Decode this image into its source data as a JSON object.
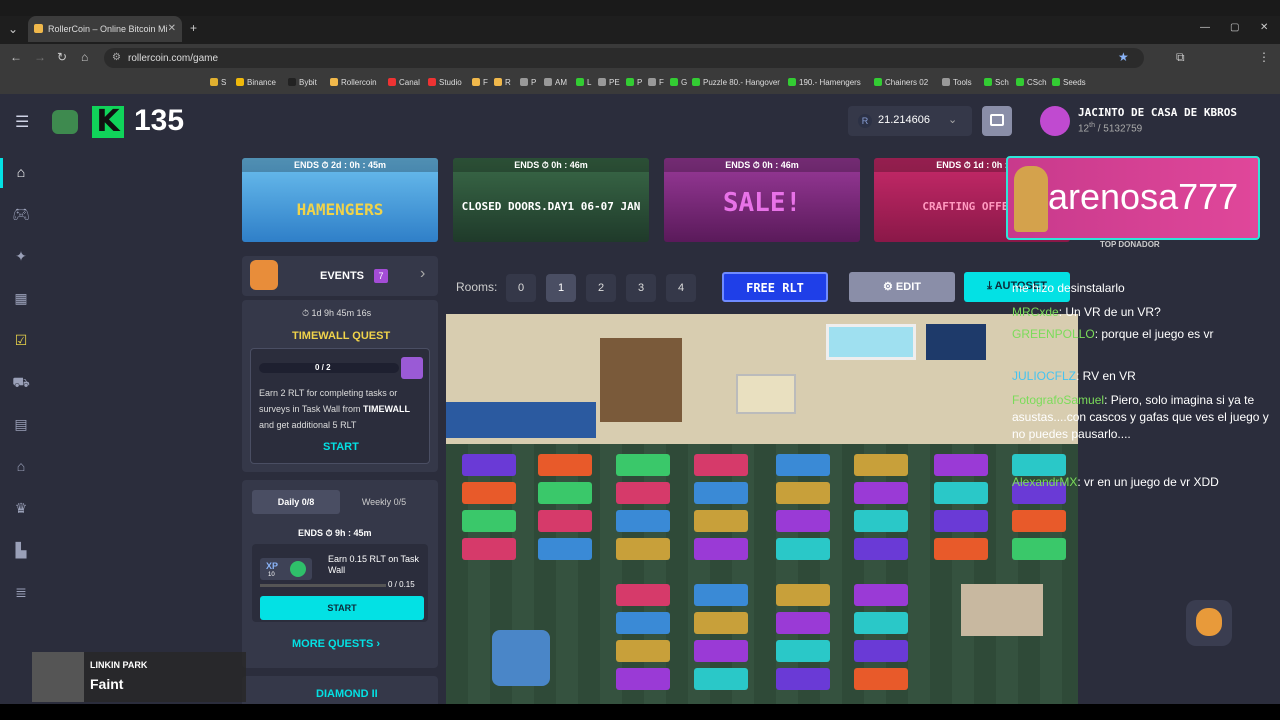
{
  "browser": {
    "tab_title": "RollerCoin – Online Bitcoin Mi",
    "url": "rollercoin.com/game",
    "bookmarks": [
      "S",
      "Binance",
      "Bybit",
      "Rollercoin",
      "Canal",
      "Studio",
      "F",
      "R",
      "P",
      "AM",
      "L",
      "PE",
      "P",
      "F",
      "G",
      "Puzzle 80.- Hangover",
      "190.- Hamengers",
      "Chainers 02",
      "Tools",
      "Sch",
      "CSch",
      "Seeds"
    ]
  },
  "topbar": {
    "level": "135",
    "balance": "21.214606",
    "user_name": "JACINTO DE CASA DE KBROS",
    "rank": "12",
    "rank_suffix": "th",
    "rank_total": "/ 5132759"
  },
  "banners": [
    {
      "ends": "ENDS  ⏱ 2d : 0h : 45m",
      "text": "HAMENGERS",
      "color": "#2f9de0"
    },
    {
      "ends": "ENDS  ⏱ 0h : 46m",
      "text": "CLOSED DOORS.DAY1 06-07 JAN",
      "color": "#2b5a3a"
    },
    {
      "ends": "ENDS  ⏱ 0h : 46m",
      "text": "SALE!",
      "color": "#7a2a7a"
    },
    {
      "ends": "ENDS  ⏱ 1d : 0h :",
      "text": "CRAFTING OFFER!",
      "color": "#a8205a"
    }
  ],
  "streamer": {
    "name": "arenosa777",
    "badge": "TOP DONADOR"
  },
  "events": {
    "label": "EVENTS",
    "count": "7"
  },
  "timewall": {
    "timer": "1d 9h 45m 16s",
    "title": "TIMEWALL QUEST",
    "progress": "0 / 2",
    "progress_fraction": 0,
    "desc_pre": "Earn 2 RLT for completing tasks or surveys in Task Wall from ",
    "desc_brand": "TIMEWALL",
    "desc_post": " and get additional 5 RLT",
    "start": "START"
  },
  "daily": {
    "tab_daily": "Daily  0/8",
    "tab_weekly": "Weekly  0/5",
    "ends": "ENDS  ⏱  9h : 45m",
    "task": "Earn 0.15 RLT on Task Wall",
    "progress": "0 / 0.15",
    "progress_fraction": 0,
    "xp": "10",
    "start": "START",
    "more": "MORE QUESTS",
    "diamond": "DIAMOND II"
  },
  "rooms": {
    "label": "Rooms:",
    "items": [
      "0",
      "1",
      "2",
      "3",
      "4"
    ],
    "active": "1",
    "free": "FREE RLT",
    "edit": "EDIT",
    "autoset": "AUTOSET"
  },
  "chat": [
    {
      "user": "",
      "text": "me hizo desinstalarlo"
    },
    {
      "user": "MRCxde",
      "text": ": Un VR de un VR?"
    },
    {
      "user": "GREENPOLLO",
      "text": ": porque el juego es vr"
    },
    {
      "user": "JULIOCFLZ",
      "text": ": RV en VR"
    },
    {
      "user": "FotografoSamuel",
      "text": ": Piero, solo imagina si ya te asustas....con cascos y gafas que ves el juego y no puedes pausarlo...."
    },
    {
      "user": "AlexandrMX",
      "text": ": vr en un juego de vr XDD"
    }
  ],
  "music": {
    "artist": "LINKIN PARK",
    "song": "Faint"
  }
}
